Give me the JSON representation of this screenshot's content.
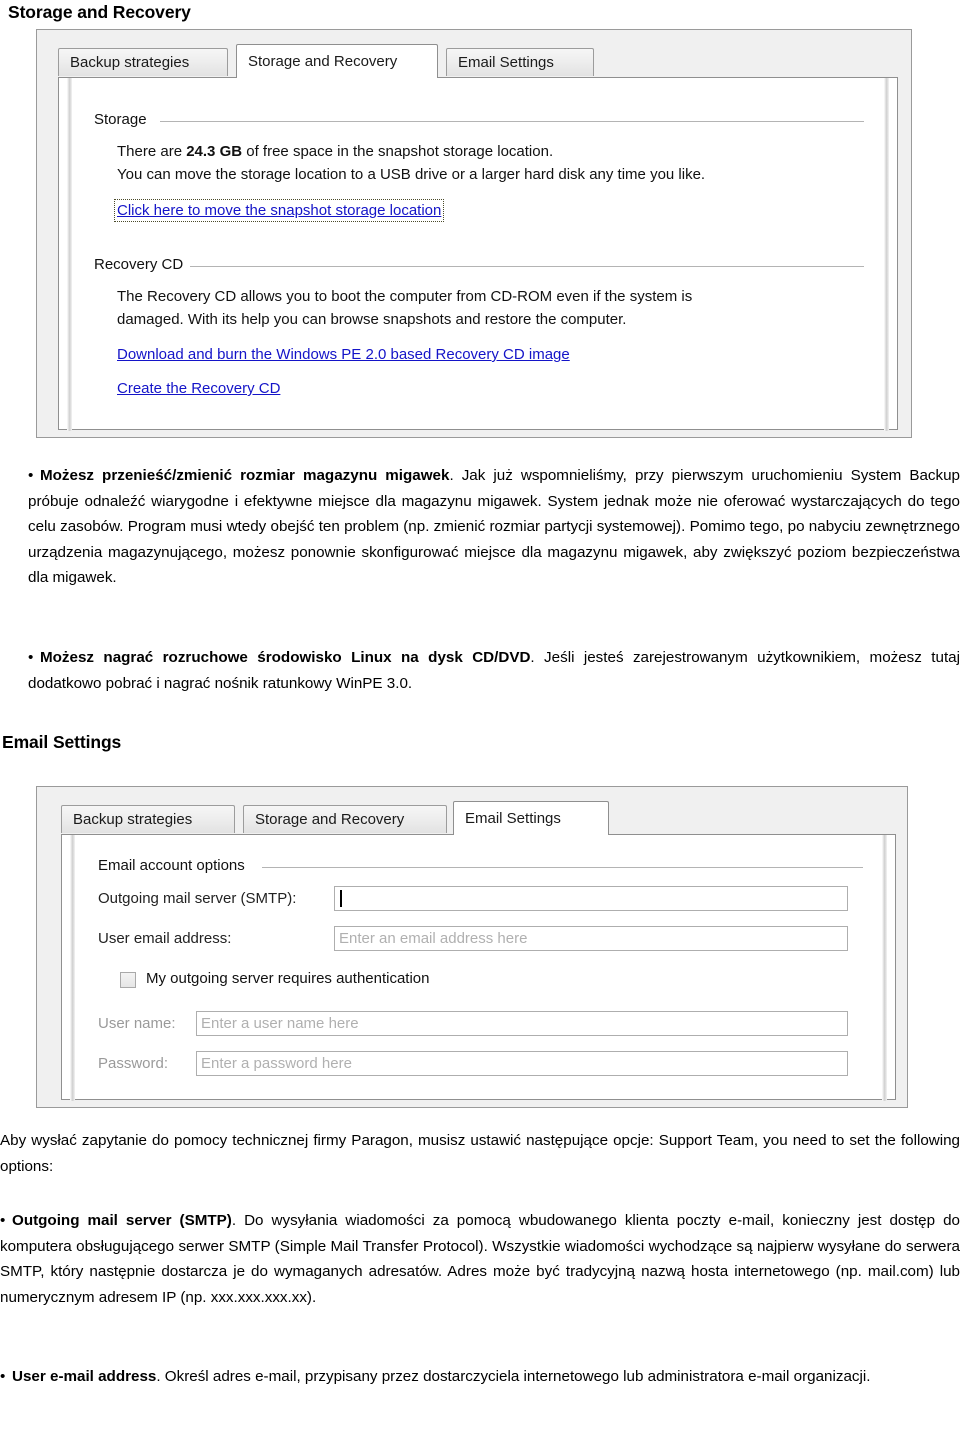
{
  "document": {
    "page_title": "Storage and Recovery",
    "email_settings_heading": "Email Settings"
  },
  "screenshot_storage": {
    "tabs": [
      {
        "label": "Backup strategies",
        "active": false
      },
      {
        "label": "Storage and Recovery",
        "active": true
      },
      {
        "label": "Email Settings",
        "active": false
      }
    ],
    "storage_group": {
      "title": "Storage",
      "line1_prefix": "There are ",
      "line1_value": "24.3 GB",
      "line1_suffix": " of free space in the snapshot storage location.",
      "line2": "You can move the storage location to a USB drive or a larger hard disk any time you like.",
      "link": "Click here to move the snapshot storage location"
    },
    "recovery_group": {
      "title": "Recovery CD",
      "line1": "The Recovery CD allows you to boot the computer from CD-ROM even if the system is",
      "line2": "damaged. With its help you can browse snapshots and restore the computer.",
      "link1": "Download and burn the Windows PE 2.0 based Recovery CD image",
      "link2": "Create the Recovery CD"
    }
  },
  "screenshot_email": {
    "tabs": [
      {
        "label": "Backup strategies",
        "active": false
      },
      {
        "label": "Storage and Recovery",
        "active": false
      },
      {
        "label": "Email Settings",
        "active": true
      }
    ],
    "group_title": "Email account options",
    "fields": {
      "smtp_label": "Outgoing mail server (SMTP):",
      "smtp_value": "",
      "email_label": "User email address:",
      "email_placeholder": "Enter an email address here",
      "auth_checkbox_label": "My outgoing server requires authentication",
      "auth_checked": false,
      "username_label": "User name:",
      "username_placeholder": "Enter a user name here",
      "password_label": "Password:",
      "password_placeholder": "Enter a password here"
    }
  },
  "body_text": {
    "p1_bold": "Możesz przenieść/zmienić rozmiar magazynu migawek",
    "p1_rest": ". Jak już wspomnieliśmy, przy pierwszym uruchomieniu System Backup próbuje odnaleźć wiarygodne i efektywne miejsce dla magazynu migawek. System jednak może nie oferować wystarczających do tego celu zasobów. Program musi wtedy obejść ten problem (np. zmienić rozmiar partycji systemowej). Pomimo tego, po nabyciu zewnętrznego urządzenia magazynującego, możesz ponownie skonfigurować miejsce dla magazynu migawek, aby zwiększyć poziom bezpieczeństwa dla migawek.",
    "p2_bold": "Możesz nagrać rozruchowe środowisko Linux na dysk CD/DVD",
    "p2_rest": ". Jeśli jesteś zarejestrowanym użytkownikiem, możesz tutaj dodatkowo pobrać i nagrać nośnik ratunkowy WinPE 3.0.",
    "p3": "Aby wysłać zapytanie do pomocy technicznej firmy Paragon, musisz ustawić następujące opcje: Support Team, you need to set the following options:",
    "p4_bold": "Outgoing mail server (SMTP)",
    "p4_rest": ". Do wysyłania wiadomości za pomocą wbudowanego klienta poczty e-mail, konieczny jest dostęp do komputera obsługującego serwer SMTP (Simple Mail Transfer Protocol). Wszystkie wiadomości wychodzące są najpierw wysyłane do serwera SMTP, który następnie dostarcza je do wymaganych adresatów. Adres może być tradycyjną nazwą hosta internetowego (np. mail.com) lub numerycznym adresem IP (np. xxx.xxx.xxx.xx).",
    "p5_bold": "User e-mail address",
    "p5_rest": ". Określ adres e-mail, przypisany przez dostarczyciela internetowego lub administratora e-mail organizacji.",
    "bullet": "•"
  },
  "colors": {
    "link": "#1414c8",
    "dialog_bg": "#f0f0f0",
    "placeholder": "#b0b0b0"
  }
}
